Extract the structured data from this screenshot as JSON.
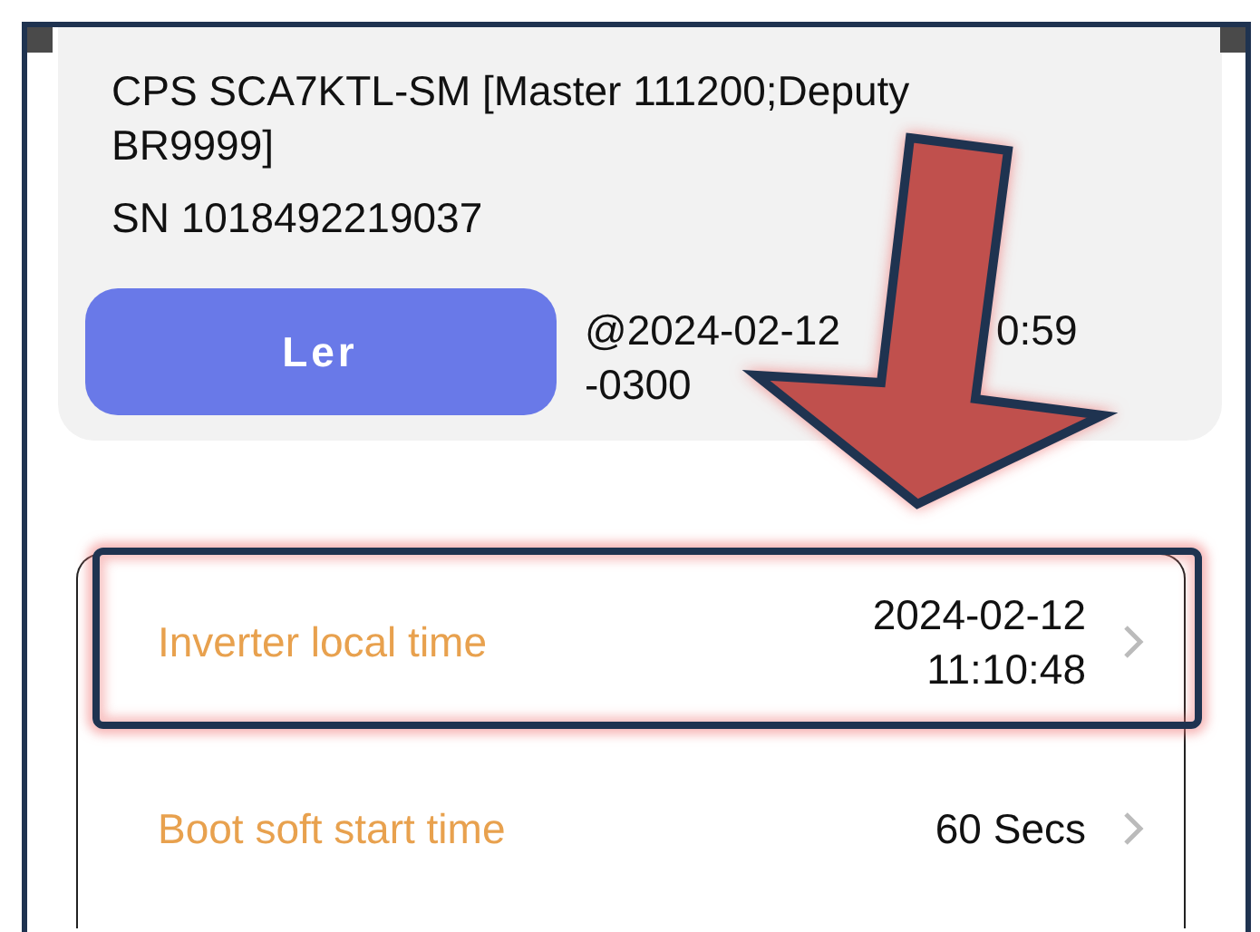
{
  "device": {
    "model": "CPS SCA7KTL-SM [Master 111200;Deputy BR9999]",
    "serial": "SN 1018492219037"
  },
  "read": {
    "button": "Ler",
    "timestamp_start": "@2024-02-12",
    "timestamp_end": "0:59",
    "timezone": "-0300"
  },
  "settings": [
    {
      "label": "Inverter local time",
      "value": "2024-02-12 11:10:48",
      "highlighted": true
    },
    {
      "label": "Boot soft start time",
      "value": "60 Secs",
      "highlighted": false
    }
  ]
}
